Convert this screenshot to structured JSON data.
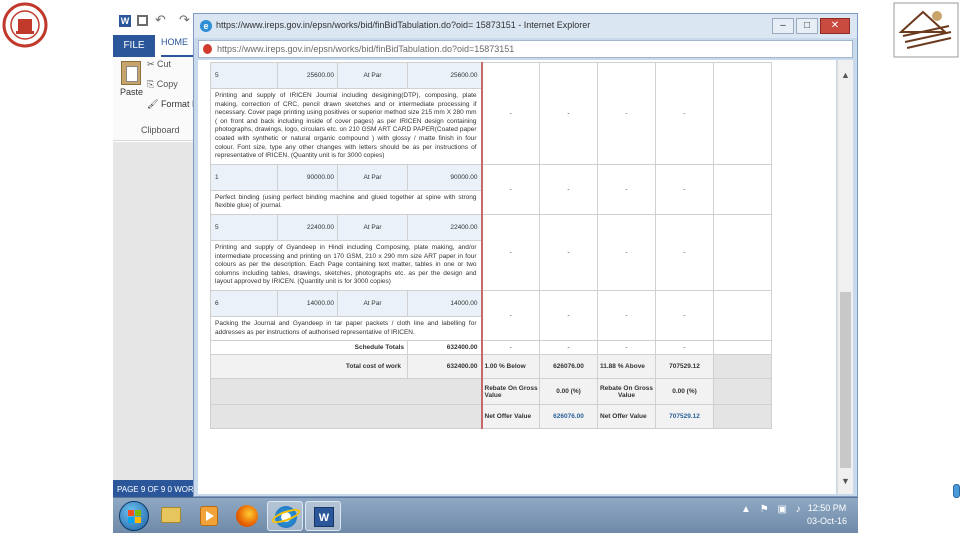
{
  "word": {
    "file_tab": "FILE",
    "home_tab": "HOME",
    "paste": "Paste",
    "cut": "Cut",
    "copy": "Copy",
    "format_painter": "Format Pa",
    "clipboard": "Clipboard",
    "status": "PAGE 9 OF 9    0 WORI"
  },
  "ie": {
    "title": "https://www.ireps.gov.in/epsn/works/bid/finBidTabulation.do?oid= 15873151 - Internet Explorer",
    "url": "https://www.ireps.gov.in/epsn/works/bid/finBidTabulation.do?oid=15873151",
    "minimize": "–",
    "maximize": "□",
    "close": "✕"
  },
  "table": {
    "rows": [
      {
        "item": {
          "qty": "5",
          "rate": "25600.00",
          "at_par": "At Par",
          "amount": "25600.00"
        },
        "description": "Printing and supply of IRICEN Journal including desigining(DTP), composing, plate making, correction of CRC, pencil drawn sketches and or intermediate processing if necessary. Cover page printing using positives or superior method size 215 mm X 280 mm ( on front and back including inside of cover pages) as per IRICEN design containing photographs, drawings, logo, circulars etc. on 210 GSM ART CARD PAPER(Coated paper coated with synthetic or natural organic compound ) with glossy / matte finish in four colour. Font size, type any other changes with letters should be as per instructions of representative of IRICEN. (Quantity unit is for 3000 copies)",
        "bids": [
          "-",
          "-",
          "-",
          "-"
        ]
      },
      {
        "item": {
          "qty": "1",
          "rate": "90000.00",
          "at_par": "At Par",
          "amount": "90000.00"
        },
        "description": "Perfect binding (using perfect binding machine and glued together at spine with strong flexible glue) of journal.",
        "bids": [
          "-",
          "-",
          "-",
          "-"
        ]
      },
      {
        "item": {
          "qty": "5",
          "rate": "22400.00",
          "at_par": "At Par",
          "amount": "22400.00"
        },
        "description": "Printing and supply of Gyandeep in Hindi including Composing, plate making, and/or intermediate processing and printing on 170 GSM, 210 x 290 mm size ART paper in four colours as per the description. Each Page containing text matter, tables in one or two columns including tables, drawings, sketches, photographs etc. as per the design and layout approved by IRICEN. (Quantity unit is for 3000 copies)",
        "bids": [
          "-",
          "-",
          "-",
          "-"
        ]
      },
      {
        "item": {
          "qty": "6",
          "rate": "14000.00",
          "at_par": "At Par",
          "amount": "14000.00"
        },
        "description": "Packing the Journal and Gyandeep in tar paper packets / cloth line and labelling for addresses as per instructions of authorised representative of IRICEN.",
        "bids": [
          "-",
          "-",
          "-",
          "-"
        ]
      }
    ],
    "schedule_totals": {
      "label": "Schedule Totals",
      "value": "632400.00",
      "bids": [
        "-",
        "-",
        "-",
        "-"
      ]
    },
    "total_cost": {
      "label": "Total cost of work",
      "value": "632400.00",
      "pct1": "1.00 % Below",
      "val1": "626076.00",
      "pct2": "11.88 % Above",
      "val2": "707529.12"
    },
    "rebate": {
      "label1": "Rebate On Gross Value",
      "pct1": "0.00 (%)",
      "label2": "Rebate On Gross Value",
      "pct2": "0.00 (%)"
    },
    "net_offer": {
      "label1": "Net Offer Value",
      "val1": "626076.00",
      "label2": "Net Offer Value",
      "val2": "707529.12"
    }
  },
  "taskbar": {
    "time": "12:50 PM",
    "date": "03-Oct-16",
    "word_letter": "W"
  }
}
